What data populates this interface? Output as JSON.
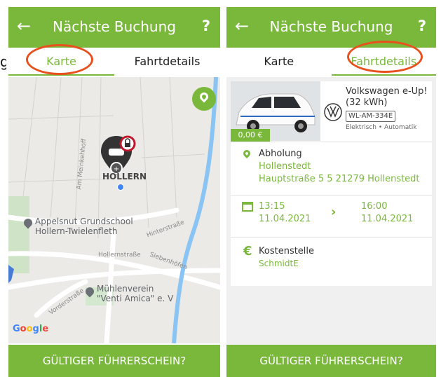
{
  "left_screen": {
    "appbar": {
      "back_icon": "arrow-left-icon",
      "title": "Nächste Buchung",
      "help": "?"
    },
    "tabs": [
      {
        "label": "Karte",
        "active": true
      },
      {
        "label": "Fahrtdetails",
        "active": false
      }
    ],
    "map": {
      "pin_label": "HOLLERN",
      "street_labels": [
        "Am Meinkehhoff",
        "Hinterstraße",
        "Hollernstraße",
        "Siebenhöfen",
        "Vorderstraße"
      ],
      "poi_1": [
        "Appelsnut Grundschool",
        "Hollern-Twielenfleth"
      ],
      "poi_2": [
        "Mühlenverein",
        "\"Venti Amica\" e. V"
      ],
      "attribution": [
        "G",
        "o",
        "o",
        "g",
        "l",
        "e"
      ]
    },
    "bottom_button": "GÜLTIGER FÜHRERSCHEIN?"
  },
  "right_screen": {
    "appbar": {
      "back_icon": "arrow-left-icon",
      "title": "Nächste Buchung",
      "help": "?"
    },
    "tabs": [
      {
        "label": "Karte",
        "active": false
      },
      {
        "label": "Fahrtdetails",
        "active": true
      }
    ],
    "vehicle": {
      "price": "0,00 €",
      "name": "Volkswagen e-Up!",
      "battery": "(32 kWh)",
      "plate": "WL-AM-334E",
      "specs": "Elektrisch • Automatik"
    },
    "pickup": {
      "label": "Abholung",
      "location": "Hollenstedt",
      "address": "Hauptstraße 5 5 21279 Hollenstedt"
    },
    "schedule": {
      "start_time": "13:15",
      "start_date": "11.04.2021",
      "end_time": "16:00",
      "end_date": "11.04.2021"
    },
    "cost_center": {
      "label": "Kostenstelle",
      "value": "SchmidtE"
    },
    "bottom_button": "GÜLTIGER FÜHRERSCHEIN?"
  },
  "colors": {
    "brand_green": "#7ab83c",
    "annotation_orange": "#e8501e",
    "lock_red": "#c0182b",
    "map_bg": "#eceae6",
    "road_blue": "#89c4f4"
  }
}
